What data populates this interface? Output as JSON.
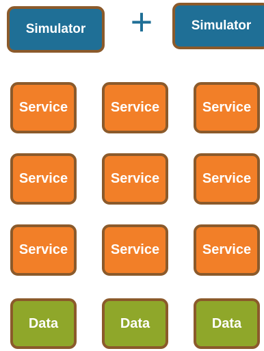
{
  "simulators": [
    "Simulator",
    "Simulator"
  ],
  "operator": "+",
  "services": [
    [
      "Service",
      "Service",
      "Service"
    ],
    [
      "Service",
      "Service",
      "Service"
    ],
    [
      "Service",
      "Service",
      "Service"
    ]
  ],
  "data_stores": [
    "Data",
    "Data",
    "Data"
  ],
  "colors": {
    "simulator": "#1f6f96",
    "service": "#f27f28",
    "data": "#8fa72a",
    "border": "#8b5a2b"
  }
}
